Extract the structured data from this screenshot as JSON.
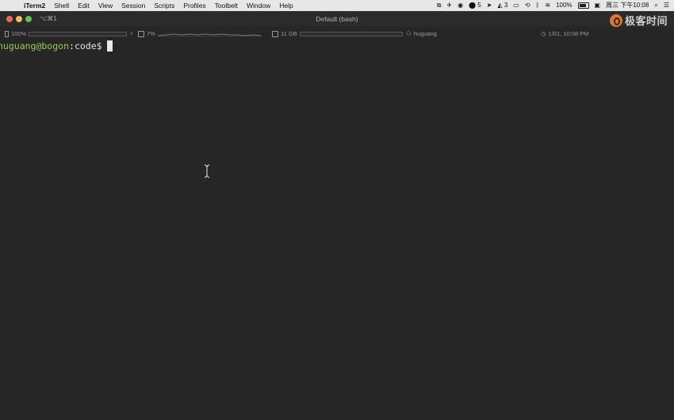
{
  "menubar": {
    "apple_icon": "apple-icon",
    "app_name": "iTerm2",
    "menus": [
      "Shell",
      "Edit",
      "View",
      "Session",
      "Scripts",
      "Profiles",
      "Toolbelt",
      "Window",
      "Help"
    ],
    "status": {
      "notification_count": "5",
      "app_badge_count": "3",
      "battery": "100%",
      "clock": "周三 下午10:08"
    }
  },
  "window": {
    "tab_shortcut": "⌥⌘1",
    "title": "Default (bash)",
    "logo_text": "极客时间"
  },
  "statusbar": {
    "battery": "100%",
    "battery_charge_symbol": "⚡",
    "cpu": "7%",
    "memory": "11 GB",
    "user": "huguang",
    "datetime": "1/01, 10:08 PM"
  },
  "terminal": {
    "prompt_user_host": "huguang@bogon",
    "prompt_separator": ":",
    "prompt_path": "code",
    "prompt_symbol": "$"
  },
  "colors": {
    "terminal_bg": "#262626",
    "prompt_user_color": "#9acb4b",
    "logo_accent": "#e2762d"
  }
}
